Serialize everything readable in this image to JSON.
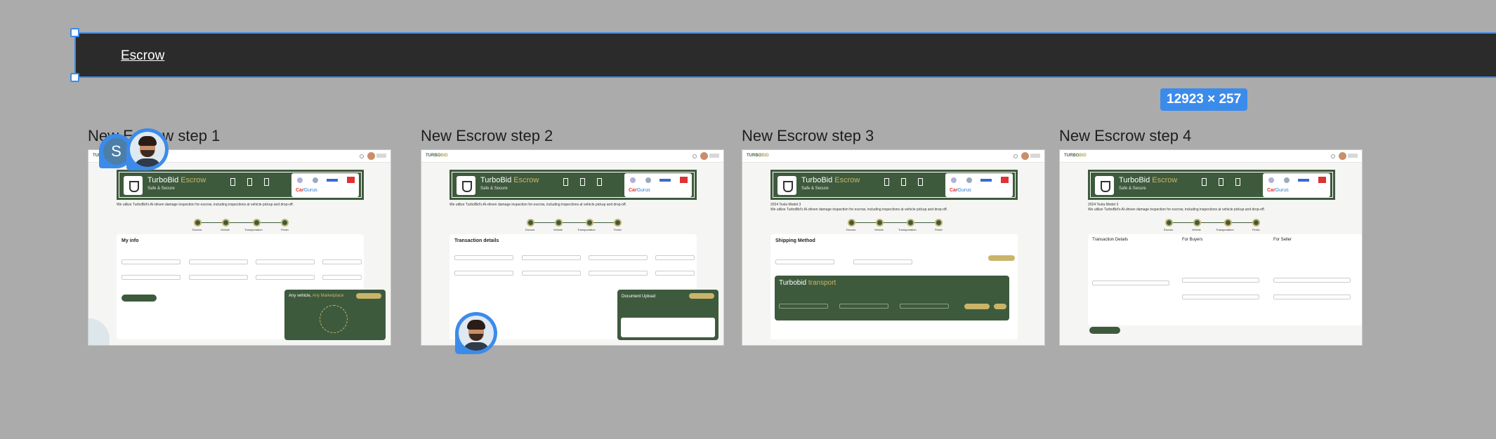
{
  "section": {
    "title": "Escrow",
    "size_label": "12923 × 257"
  },
  "frames": [
    {
      "label": "New Escrow step 1"
    },
    {
      "label": "New Escrow step 2"
    },
    {
      "label": "New Escrow step 3"
    },
    {
      "label": "New Escrow step 4"
    }
  ],
  "collaborator": {
    "initial": "S"
  },
  "screens": {
    "logo_a": "TURBO",
    "logo_b": "BID",
    "hero_title_a": "TurboBid ",
    "hero_title_b": "Escrow",
    "hero_sub": "Safe & Secure",
    "partner_brand_a": "Car",
    "partner_brand_b": "Gurus",
    "intro": "We utilize TurboBid's AI-driven damage inspection for escrow, including inspections at vehicle pickup and drop-off.",
    "steps": [
      "Escrow",
      "Vehicle",
      "Transportation",
      "Finish"
    ],
    "step1": {
      "card_title": "My info",
      "green_title_a": "Any vehicle, ",
      "green_title_b": "Any Marketplace"
    },
    "step2": {
      "card_title": "Transaction details",
      "upload_title": "Document Upload"
    },
    "step3": {
      "card_title": "Shipping Method",
      "vehicle": "2024 Tesla Model 3",
      "transport_a": "Turbobid ",
      "transport_b": "transport"
    },
    "step4": {
      "vehicle": "2024 Tesla Model 3",
      "col1": "Transaction Details",
      "col2": "For Buyers",
      "col3": "For Seller"
    }
  },
  "colors": {
    "accent": "#3b8beb",
    "brand_green": "#3e5a3d",
    "brand_gold": "#c9b46a"
  }
}
